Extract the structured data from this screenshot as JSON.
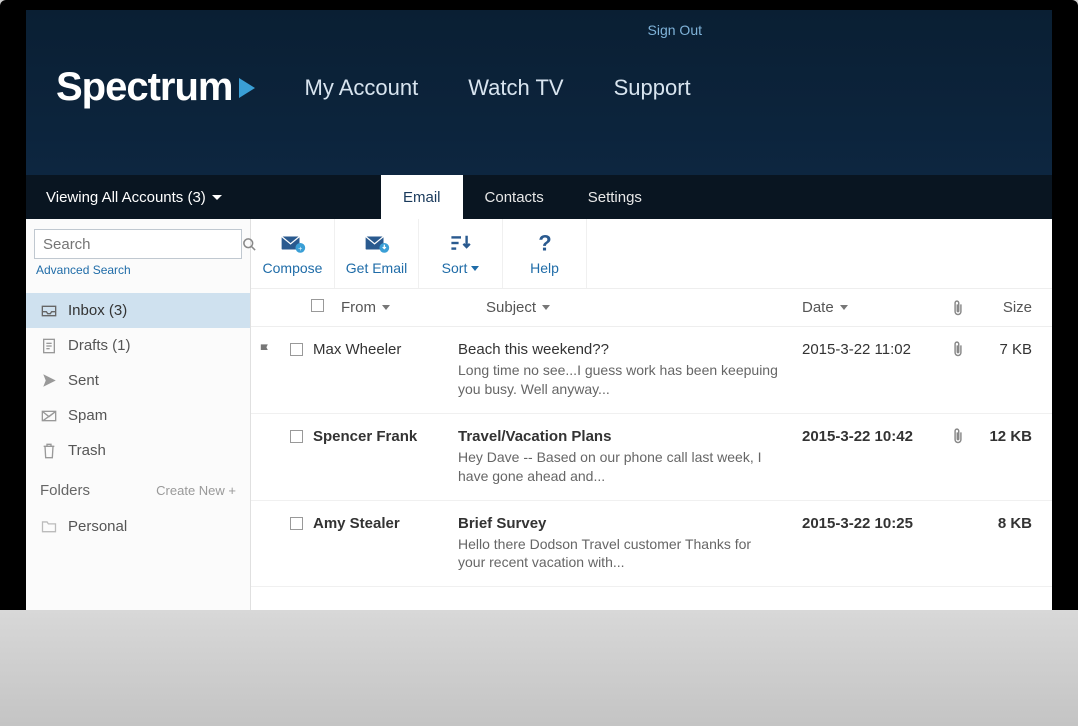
{
  "header": {
    "sign_out": "Sign Out",
    "brand": "Spectrum",
    "nav": {
      "my_account": "My Account",
      "watch_tv": "Watch TV",
      "support": "Support"
    }
  },
  "subheader": {
    "accounts_label": "Viewing All Accounts (3)",
    "tabs": {
      "email": "Email",
      "contacts": "Contacts",
      "settings": "Settings"
    }
  },
  "sidebar": {
    "search_placeholder": "Search",
    "advanced_search": "Advanced Search",
    "folders": {
      "inbox": "Inbox (3)",
      "drafts": "Drafts (1)",
      "sent": "Sent",
      "spam": "Spam",
      "trash": "Trash"
    },
    "folders_header": "Folders",
    "create_new": "Create New +",
    "personal": "Personal"
  },
  "toolbar": {
    "compose": "Compose",
    "get_email": "Get Email",
    "sort": "Sort",
    "help": "Help"
  },
  "columns": {
    "from": "From",
    "subject": "Subject",
    "date": "Date",
    "size": "Size"
  },
  "messages": [
    {
      "flagged": true,
      "bold": false,
      "from": "Max Wheeler",
      "subject": "Beach this weekend??",
      "preview": "Long time no see...I guess work has been keepuing you busy. Well anyway...",
      "date": "2015-3-22 11:02",
      "attachment": true,
      "size": "7 KB"
    },
    {
      "flagged": false,
      "bold": true,
      "from": "Spencer Frank",
      "subject": "Travel/Vacation Plans",
      "preview": "Hey Dave -- Based on our phone call last week, I have gone ahead and...",
      "date": "2015-3-22 10:42",
      "attachment": true,
      "size": "12 KB"
    },
    {
      "flagged": false,
      "bold": true,
      "from": "Amy Stealer",
      "subject": "Brief Survey",
      "preview": "Hello there Dodson Travel customer Thanks for your recent vacation with...",
      "date": "2015-3-22 10:25",
      "attachment": false,
      "size": "8 KB"
    }
  ]
}
